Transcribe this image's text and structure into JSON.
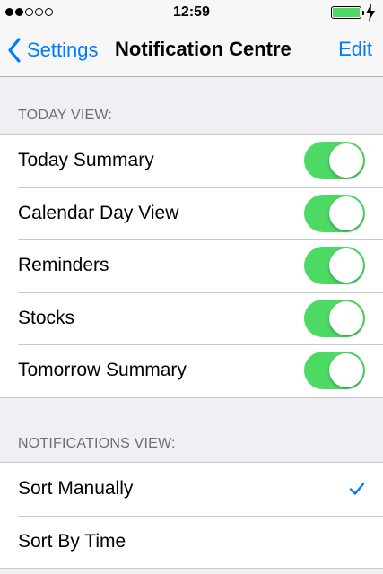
{
  "status_bar": {
    "signal_dots": [
      true,
      true,
      false,
      false,
      false
    ],
    "time": "12:59",
    "battery_color": "#4cd964"
  },
  "nav": {
    "back_label": "Settings",
    "title": "Notification Centre",
    "edit_label": "Edit",
    "accent_color": "#007aff"
  },
  "today_view": {
    "header": "TODAY VIEW:",
    "items": [
      {
        "label": "Today Summary",
        "on": true
      },
      {
        "label": "Calendar Day View",
        "on": true
      },
      {
        "label": "Reminders",
        "on": true
      },
      {
        "label": "Stocks",
        "on": true
      },
      {
        "label": "Tomorrow Summary",
        "on": true
      }
    ]
  },
  "notifications_view": {
    "header": "NOTIFICATIONS VIEW:",
    "items": [
      {
        "label": "Sort Manually",
        "selected": true
      },
      {
        "label": "Sort By Time",
        "selected": false
      }
    ]
  }
}
